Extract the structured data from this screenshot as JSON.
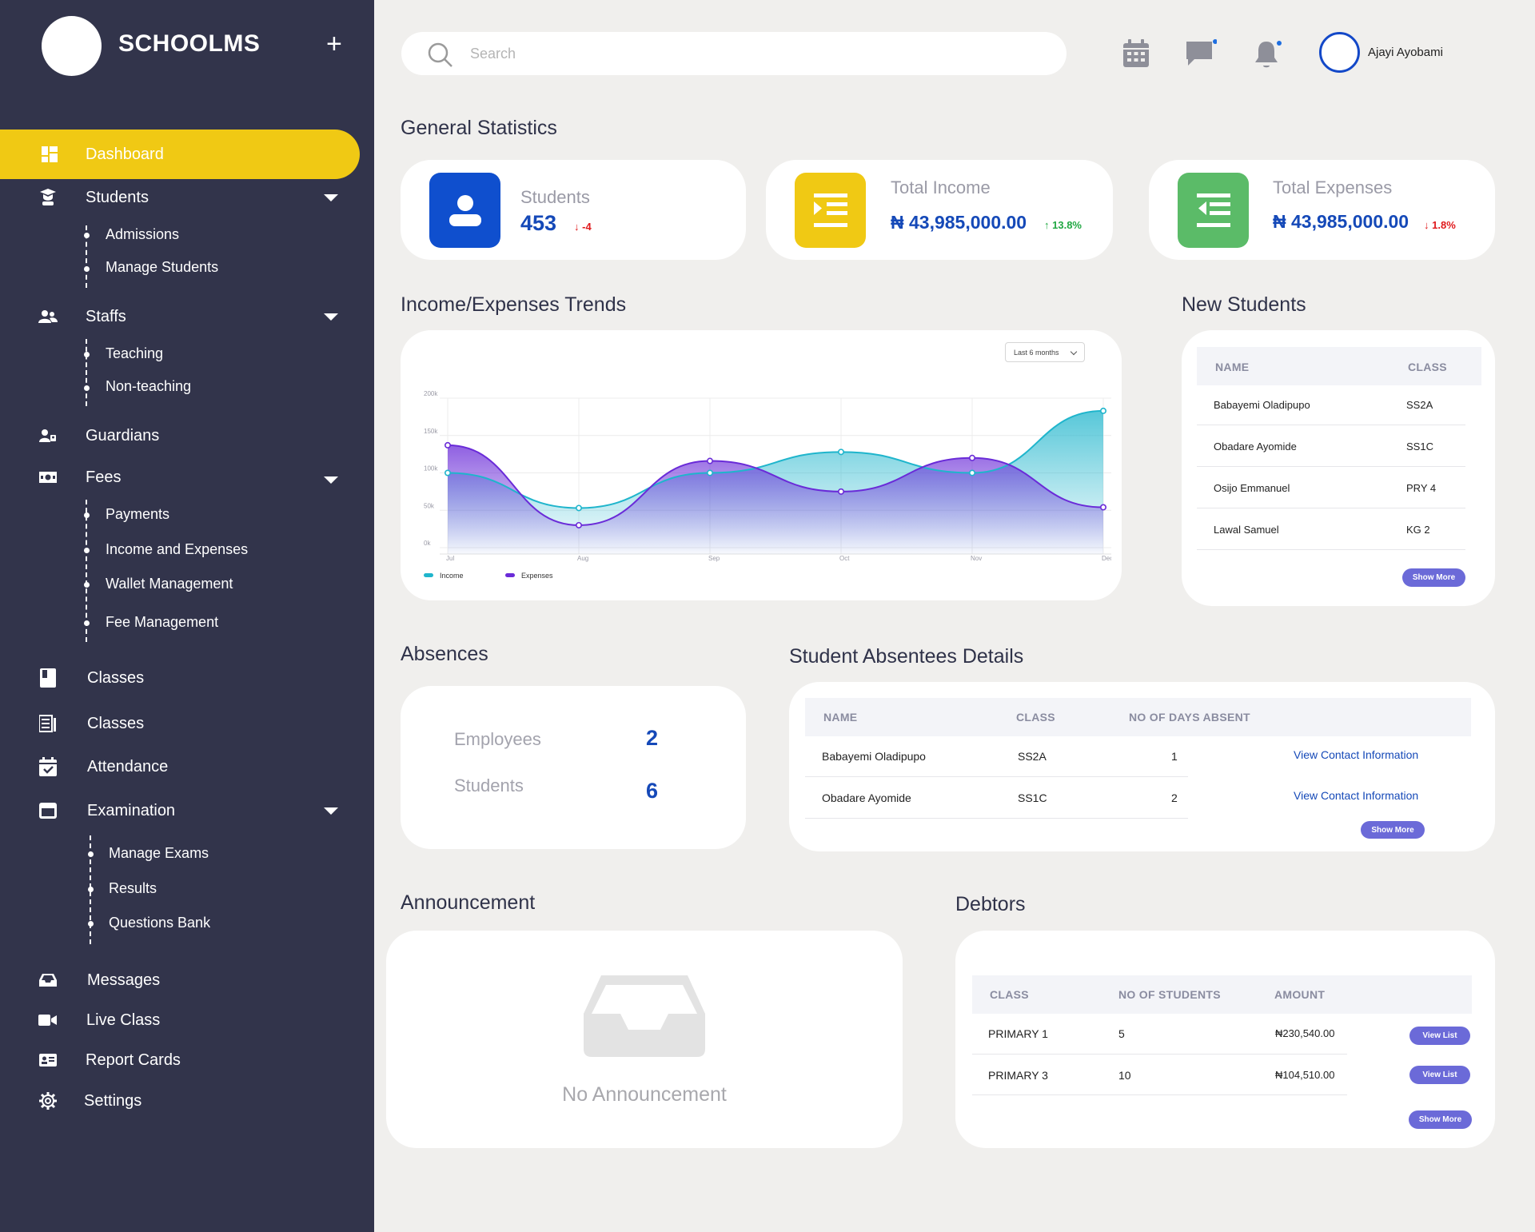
{
  "brand": {
    "name": "SCHOOLMS",
    "add_symbol": "+"
  },
  "nav": {
    "dashboard": "Dashboard",
    "students": "Students",
    "students_sub": [
      "Admissions",
      "Manage Students"
    ],
    "staffs": "Staffs",
    "staffs_sub": [
      "Teaching",
      "Non-teaching"
    ],
    "guardians": "Guardians",
    "fees": "Fees",
    "fees_sub": [
      "Payments",
      "Income and Expenses",
      "Wallet Management",
      "Fee Management"
    ],
    "classes_1": "Classes",
    "classes_2": "Classes",
    "attendance": "Attendance",
    "examination": "Examination",
    "examination_sub": [
      "Manage Exams",
      "Results",
      "Questions Bank"
    ],
    "messages": "Messages",
    "live_class": "Live Class",
    "report_cards": "Report Cards",
    "settings": "Settings"
  },
  "topbar": {
    "search_placeholder": "Search",
    "user_name": "Ajayi Ayobami"
  },
  "general_statistics": {
    "title": "General Statistics",
    "students": {
      "label": "Students",
      "value": "453",
      "change": "-4",
      "direction": "down"
    },
    "income": {
      "label": "Total Income",
      "value": "₦ 43,985,000.00",
      "change": "13.8%",
      "direction": "up"
    },
    "expenses": {
      "label": "Total Expenses",
      "value": "₦ 43,985,000.00",
      "change": "1.8%",
      "direction": "down"
    }
  },
  "trends": {
    "title": "Income/Expenses Trends",
    "range_select": "Last 6 months"
  },
  "chart_data": {
    "type": "area",
    "categories": [
      "Jul",
      "Aug",
      "Sep",
      "Oct",
      "Nov",
      "Dec"
    ],
    "y_ticks": [
      "0k",
      "50k",
      "100k",
      "150k",
      "200k"
    ],
    "ylim": [
      0,
      200
    ],
    "grid": true,
    "legend_position": "bottom-left",
    "series": [
      {
        "name": "Income",
        "values": [
          100,
          53,
          100,
          128,
          100,
          183
        ],
        "color": "#1fb5cc"
      },
      {
        "name": "Expenses",
        "values": [
          137,
          30,
          116,
          75,
          120,
          54
        ],
        "color": "#6a2bd8"
      }
    ]
  },
  "new_students": {
    "title": "New Students",
    "columns": [
      "NAME",
      "CLASS"
    ],
    "rows": [
      [
        "Babayemi Oladipupo",
        "SS2A"
      ],
      [
        "Obadare Ayomide",
        "SS1C"
      ],
      [
        "Osijo Emmanuel",
        "PRY 4"
      ],
      [
        "Lawal Samuel",
        "KG 2"
      ]
    ],
    "show_more": "Show More"
  },
  "absences": {
    "title": "Absences",
    "employees_label": "Employees",
    "employees_value": "2",
    "students_label": "Students",
    "students_value": "6"
  },
  "absentees": {
    "title": "Student Absentees Details",
    "columns": [
      "NAME",
      "CLASS",
      "NO OF DAYS ABSENT"
    ],
    "rows": [
      [
        "Babayemi Oladipupo",
        "SS2A",
        "1"
      ],
      [
        "Obadare Ayomide",
        "SS1C",
        "2"
      ]
    ],
    "link_label": "View Contact Information",
    "show_more": "Show More"
  },
  "announcement": {
    "title": "Announcement",
    "empty": "No Announcement"
  },
  "debtors": {
    "title": "Debtors",
    "columns": [
      "CLASS",
      "NO OF STUDENTS",
      "AMOUNT"
    ],
    "rows": [
      [
        "PRIMARY 1",
        "5",
        "₦230,540.00"
      ],
      [
        "PRIMARY 3",
        "10",
        "₦104,510.00"
      ]
    ],
    "view_list": "View List",
    "show_more": "Show More"
  },
  "colors": {
    "sidebar": "#32344b",
    "active": "#f0c914",
    "accent_blue": "#1549b8",
    "students_icon": "#0f4fce",
    "income_icon": "#f0c914",
    "expenses_icon": "#5bbb68",
    "button": "#6b6ad8"
  }
}
